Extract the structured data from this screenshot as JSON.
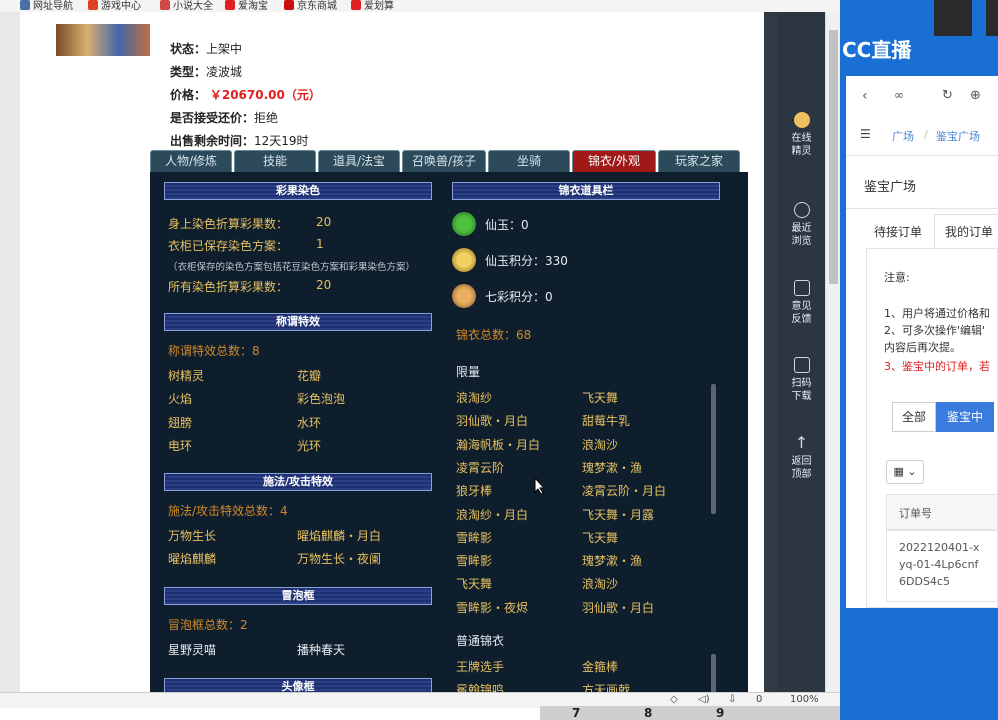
{
  "bookmarks": [
    {
      "label": "网址导航",
      "color": "#4a6fa5"
    },
    {
      "label": "游戏中心",
      "color": "#e04020"
    },
    {
      "label": "小说大全",
      "color": "#d04848"
    },
    {
      "label": "爱淘宝",
      "color": "#e02020"
    },
    {
      "label": "京东商城",
      "color": "#c81010"
    },
    {
      "label": "爱划算",
      "color": "#e02020"
    }
  ],
  "item": {
    "status_label": "状态：",
    "status": "上架中",
    "type_label": "类型：",
    "type": "凌波城",
    "price_label": "价格：",
    "price": "￥20670.00（元）",
    "bargain_label": "是否接受还价：",
    "bargain": "拒绝",
    "time_label": "出售剩余时间：",
    "time": "12天19时"
  },
  "tabs": [
    "人物/修炼",
    "技能",
    "道具/法宝",
    "召唤兽/孩子",
    "坐骑",
    "锦衣/外观",
    "玩家之家"
  ],
  "left": {
    "h1": "彩果染色",
    "dye": [
      {
        "label": "身上染色折算彩果数：",
        "value": "20"
      },
      {
        "label": "衣柜已保存染色方案：",
        "value": "1"
      }
    ],
    "note": "（衣柜保存的染色方案包括花豆染色方案和彩果染色方案）",
    "dye_total": {
      "label": "所有染色折算彩果数：",
      "value": "20"
    },
    "h2": "称谓特效",
    "title_total": "称谓特效总数：8",
    "titles": [
      "树精灵",
      "花瓣",
      "火焰",
      "彩色泡泡",
      "翅膀",
      "水环",
      "电环",
      "光环"
    ],
    "h3": "施法/攻击特效",
    "spell_total": "施法/攻击特效总数：4",
    "spells": [
      "万物生长",
      "曜焰麒麟・月白",
      "曜焰麒麟",
      "万物生长・夜阑"
    ],
    "h4": "冒泡框",
    "bubble_total": "冒泡框总数：2",
    "bubbles": [
      "星野灵喵",
      "播种春天"
    ],
    "h5": "头像框"
  },
  "right_col": {
    "h": "锦衣道具栏",
    "xianyu": "仙玉：0",
    "jifen": "仙玉积分：330",
    "qicai": "七彩积分：0",
    "total": "锦衣总数：68",
    "limited_label": "限量",
    "limited": [
      "浪淘纱",
      "飞天舞",
      "羽仙歌・月白",
      "甜莓牛乳",
      "瀚海帆板・月白",
      "浪淘沙",
      "凌霄云阶",
      "瑰梦漱・渔",
      "狼牙棒",
      "凌霄云阶・月白",
      "浪淘纱・月白",
      "飞天舞・月露",
      "雪眸影",
      "飞天舞",
      "雪眸影",
      "瑰梦漱・渔",
      "飞天舞",
      "浪淘沙",
      "雪眸影・夜烬",
      "羽仙歌・月白"
    ],
    "normal_label": "普通锦衣",
    "normal": [
      "王牌选手",
      "金箍棒",
      "冕翰锦鸣",
      "方天画戟"
    ]
  },
  "sidebar": [
    "在线精灵",
    "最近浏览",
    "意见反馈",
    "扫码下载",
    "返回顶部"
  ],
  "status_bar": {
    "zoom": "100%",
    "count": "0"
  },
  "taskbar": [
    "7",
    "8",
    "9"
  ],
  "right_panel": {
    "logo": "CC直播",
    "crumb1": "广场",
    "crumb2": "鉴宝广场",
    "title": "鉴宝广场",
    "tab1": "待接订单",
    "tab2": "我的订单",
    "notice_title": "注意:",
    "n1": "1、用户将通过价格和",
    "n2": "2、可多次操作'编辑'",
    "n2b": "内容后再次提。",
    "n3": "3、鉴宝中的订单，若",
    "btn_all": "全部",
    "btn_active": "鉴宝中",
    "col": "订单号",
    "order": "2022120401-xyq-01-4Lp6cnf6DDS4c5"
  }
}
